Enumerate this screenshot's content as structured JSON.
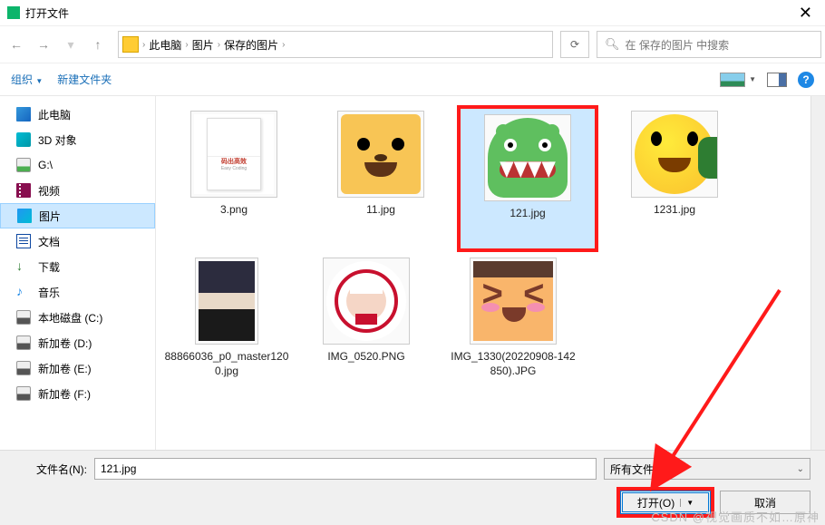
{
  "titlebar": {
    "title": "打开文件"
  },
  "nav": {
    "breadcrumb": [
      "此电脑",
      "图片",
      "保存的图片"
    ],
    "search_placeholder": "在 保存的图片 中搜索"
  },
  "toolbar": {
    "organize": "组织",
    "new_folder": "新建文件夹"
  },
  "sidebar": {
    "items": [
      {
        "label": "此电脑",
        "icon": "pc"
      },
      {
        "label": "3D 对象",
        "icon": "3d"
      },
      {
        "label": "G:\\",
        "icon": "drive"
      },
      {
        "label": "视频",
        "icon": "video"
      },
      {
        "label": "图片",
        "icon": "pic",
        "active": true
      },
      {
        "label": "文档",
        "icon": "doc"
      },
      {
        "label": "下载",
        "icon": "dl"
      },
      {
        "label": "音乐",
        "icon": "music"
      },
      {
        "label": "本地磁盘 (C:)",
        "icon": "hdd"
      },
      {
        "label": "新加卷 (D:)",
        "icon": "hdd"
      },
      {
        "label": "新加卷 (E:)",
        "icon": "hdd"
      },
      {
        "label": "新加卷 (F:)",
        "icon": "hdd"
      }
    ]
  },
  "files": {
    "items": [
      {
        "name": "3.png"
      },
      {
        "name": "11.jpg"
      },
      {
        "name": "121.jpg",
        "selected": true,
        "highlighted": true
      },
      {
        "name": "1231.jpg"
      },
      {
        "name": "88866036_p0_master1200.jpg"
      },
      {
        "name": "IMG_0520.PNG"
      },
      {
        "name": "IMG_1330(20220908-142850).JPG"
      }
    ]
  },
  "footer": {
    "filename_label": "文件名(N):",
    "filename_value": "121.jpg",
    "filetype_value": "所有文件 (*)",
    "open_label": "打开(O)",
    "cancel_label": "取消"
  },
  "watermark": "CSDN @视觉画质不如…原神"
}
